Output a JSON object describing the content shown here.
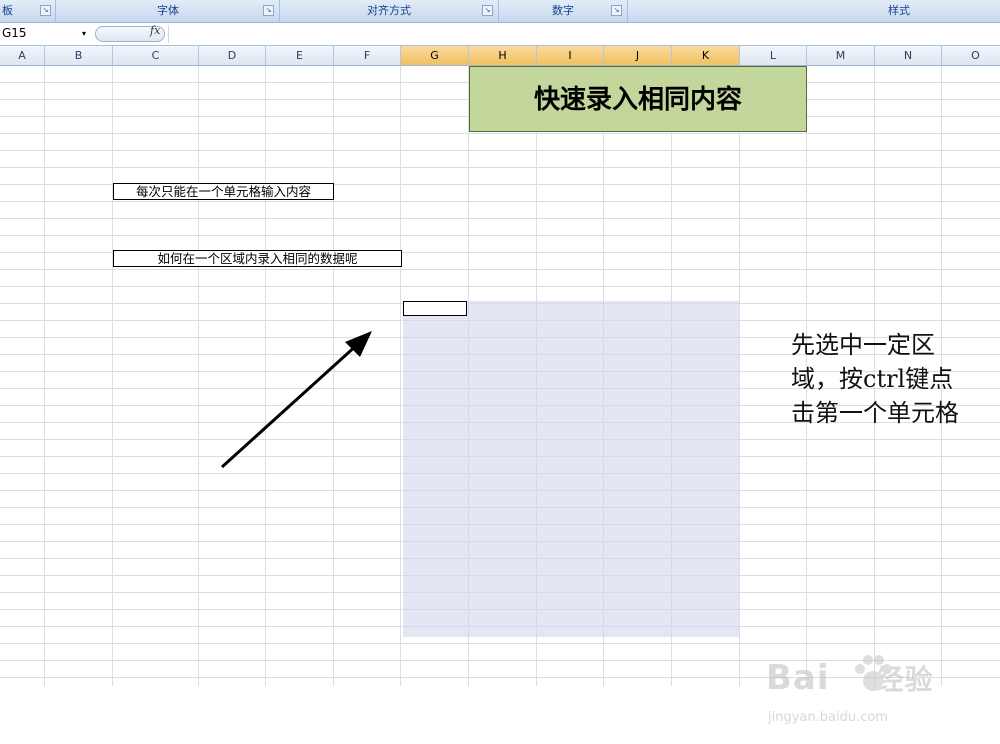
{
  "ribbon": {
    "groups": [
      {
        "label": "板"
      },
      {
        "label": "字体"
      },
      {
        "label": "对齐方式"
      },
      {
        "label": "数字"
      },
      {
        "label": "样式"
      }
    ],
    "launcher_icon": "dialog-launcher-icon"
  },
  "formula_bar": {
    "name_box": "G15",
    "name_box_arrow": "▾",
    "fx_label": "fx",
    "formula": ""
  },
  "columns": [
    "A",
    "B",
    "C",
    "D",
    "E",
    "F",
    "G",
    "H",
    "I",
    "J",
    "K",
    "L",
    "M",
    "N",
    "O"
  ],
  "selected_columns": [
    "G",
    "H",
    "I",
    "J",
    "K"
  ],
  "sheet": {
    "title": "快速录入相同内容",
    "cell_text_1": "每次只能在一个单元格输入内容",
    "cell_text_2": "如何在一个区域内录入相同的数据呢",
    "note_lines": [
      "先选中一定区",
      "域，按ctrl键点",
      "击第一个单元格"
    ]
  },
  "colors": {
    "title_fill": "#c3d69b",
    "selection_fill": "#cdd4ea",
    "header_selected": "#f1c15f"
  },
  "watermark": {
    "brand": "Bai",
    "brand_cn": "经验",
    "url": "jingyan.baidu.com"
  }
}
